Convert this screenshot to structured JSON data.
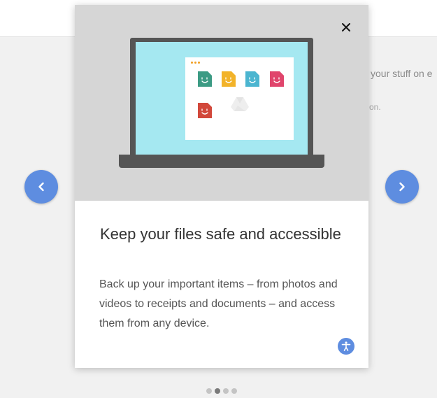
{
  "background": {
    "text_line_1": "your stuff on e",
    "text_line_2": "on."
  },
  "dialog": {
    "title": "Keep your files safe and accessible",
    "description": "Back up your important items – from photos and videos to receipts and documents – and access them from any device.",
    "close_icon": "close-icon",
    "accessibility_icon": "accessibility-icon"
  },
  "nav": {
    "prev_icon": "chevron-left-icon",
    "next_icon": "chevron-right-icon"
  },
  "pagination": {
    "total": 4,
    "active_index": 1
  },
  "illustration": {
    "file_colors": [
      "#3c9b84",
      "#f2b32a",
      "#4bb5d0",
      "#e0456c",
      "#d2483b"
    ],
    "accent_color": "#5e8de0",
    "screen_color": "#a5e8f1"
  }
}
